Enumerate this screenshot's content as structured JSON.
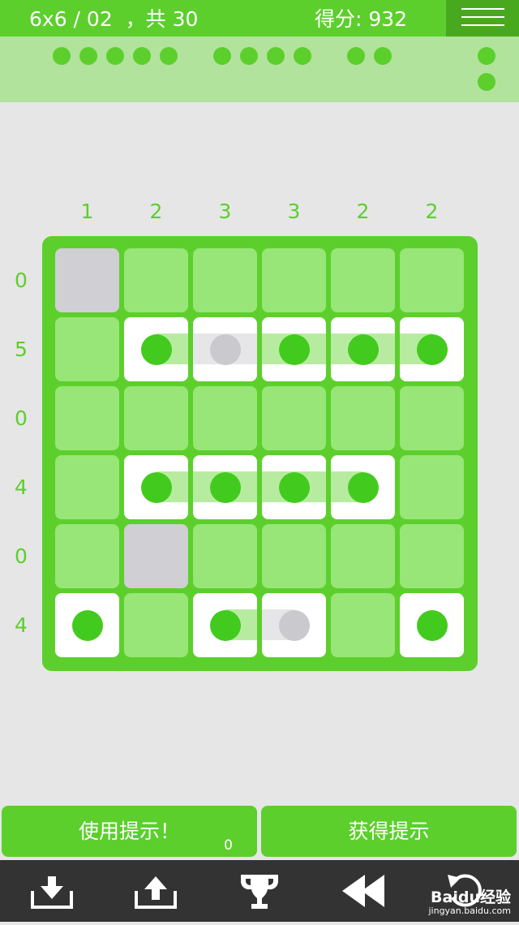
{
  "header": {
    "level_text": "6x6 / 02  ，共 30",
    "score_text": "得分: 932"
  },
  "fleet": [
    {
      "length": 5,
      "status": "found"
    },
    {
      "length": 4,
      "status": "found"
    },
    {
      "length": 2,
      "status": "found"
    },
    {
      "length": 1,
      "status": "found"
    },
    {
      "length": 1,
      "status": "found"
    }
  ],
  "puzzle": {
    "size": 6,
    "column_clues": [
      "1",
      "2",
      "3",
      "3",
      "2",
      "2"
    ],
    "row_clues": [
      "0",
      "5",
      "0",
      "4",
      "0",
      "4"
    ],
    "legend": {
      "E": "empty (grey)",
      "W": "water (green)",
      "S": "ship segment",
      "G": "ship segment (faded)"
    },
    "grid": [
      [
        "E",
        "W",
        "W",
        "W",
        "W",
        "W"
      ],
      [
        "W",
        "S",
        "G",
        "S",
        "S",
        "S"
      ],
      [
        "W",
        "W",
        "W",
        "W",
        "W",
        "W"
      ],
      [
        "W",
        "S",
        "S",
        "S",
        "S",
        "W"
      ],
      [
        "W",
        "E",
        "W",
        "W",
        "W",
        "W"
      ],
      [
        "S",
        "W",
        "S",
        "G",
        "W",
        "S"
      ]
    ]
  },
  "buttons": {
    "use_hint": "使用提示！",
    "hint_count": "0",
    "get_hint": "获得提示"
  },
  "toolbar": {
    "items": [
      "download-icon",
      "upload-icon",
      "trophy-icon",
      "rewind-icon",
      "undo-icon"
    ]
  },
  "watermark": {
    "brand": "Baidu经验",
    "url": "jingyan.baidu.com"
  },
  "colors": {
    "accent": "#5ccf2c",
    "accent_dark": "#48a91f",
    "water": "#97e677",
    "fleet_bg": "#b2e39c",
    "empty": "#cfcfd4",
    "toolbar": "#333333",
    "background": "#e6e6e6"
  }
}
